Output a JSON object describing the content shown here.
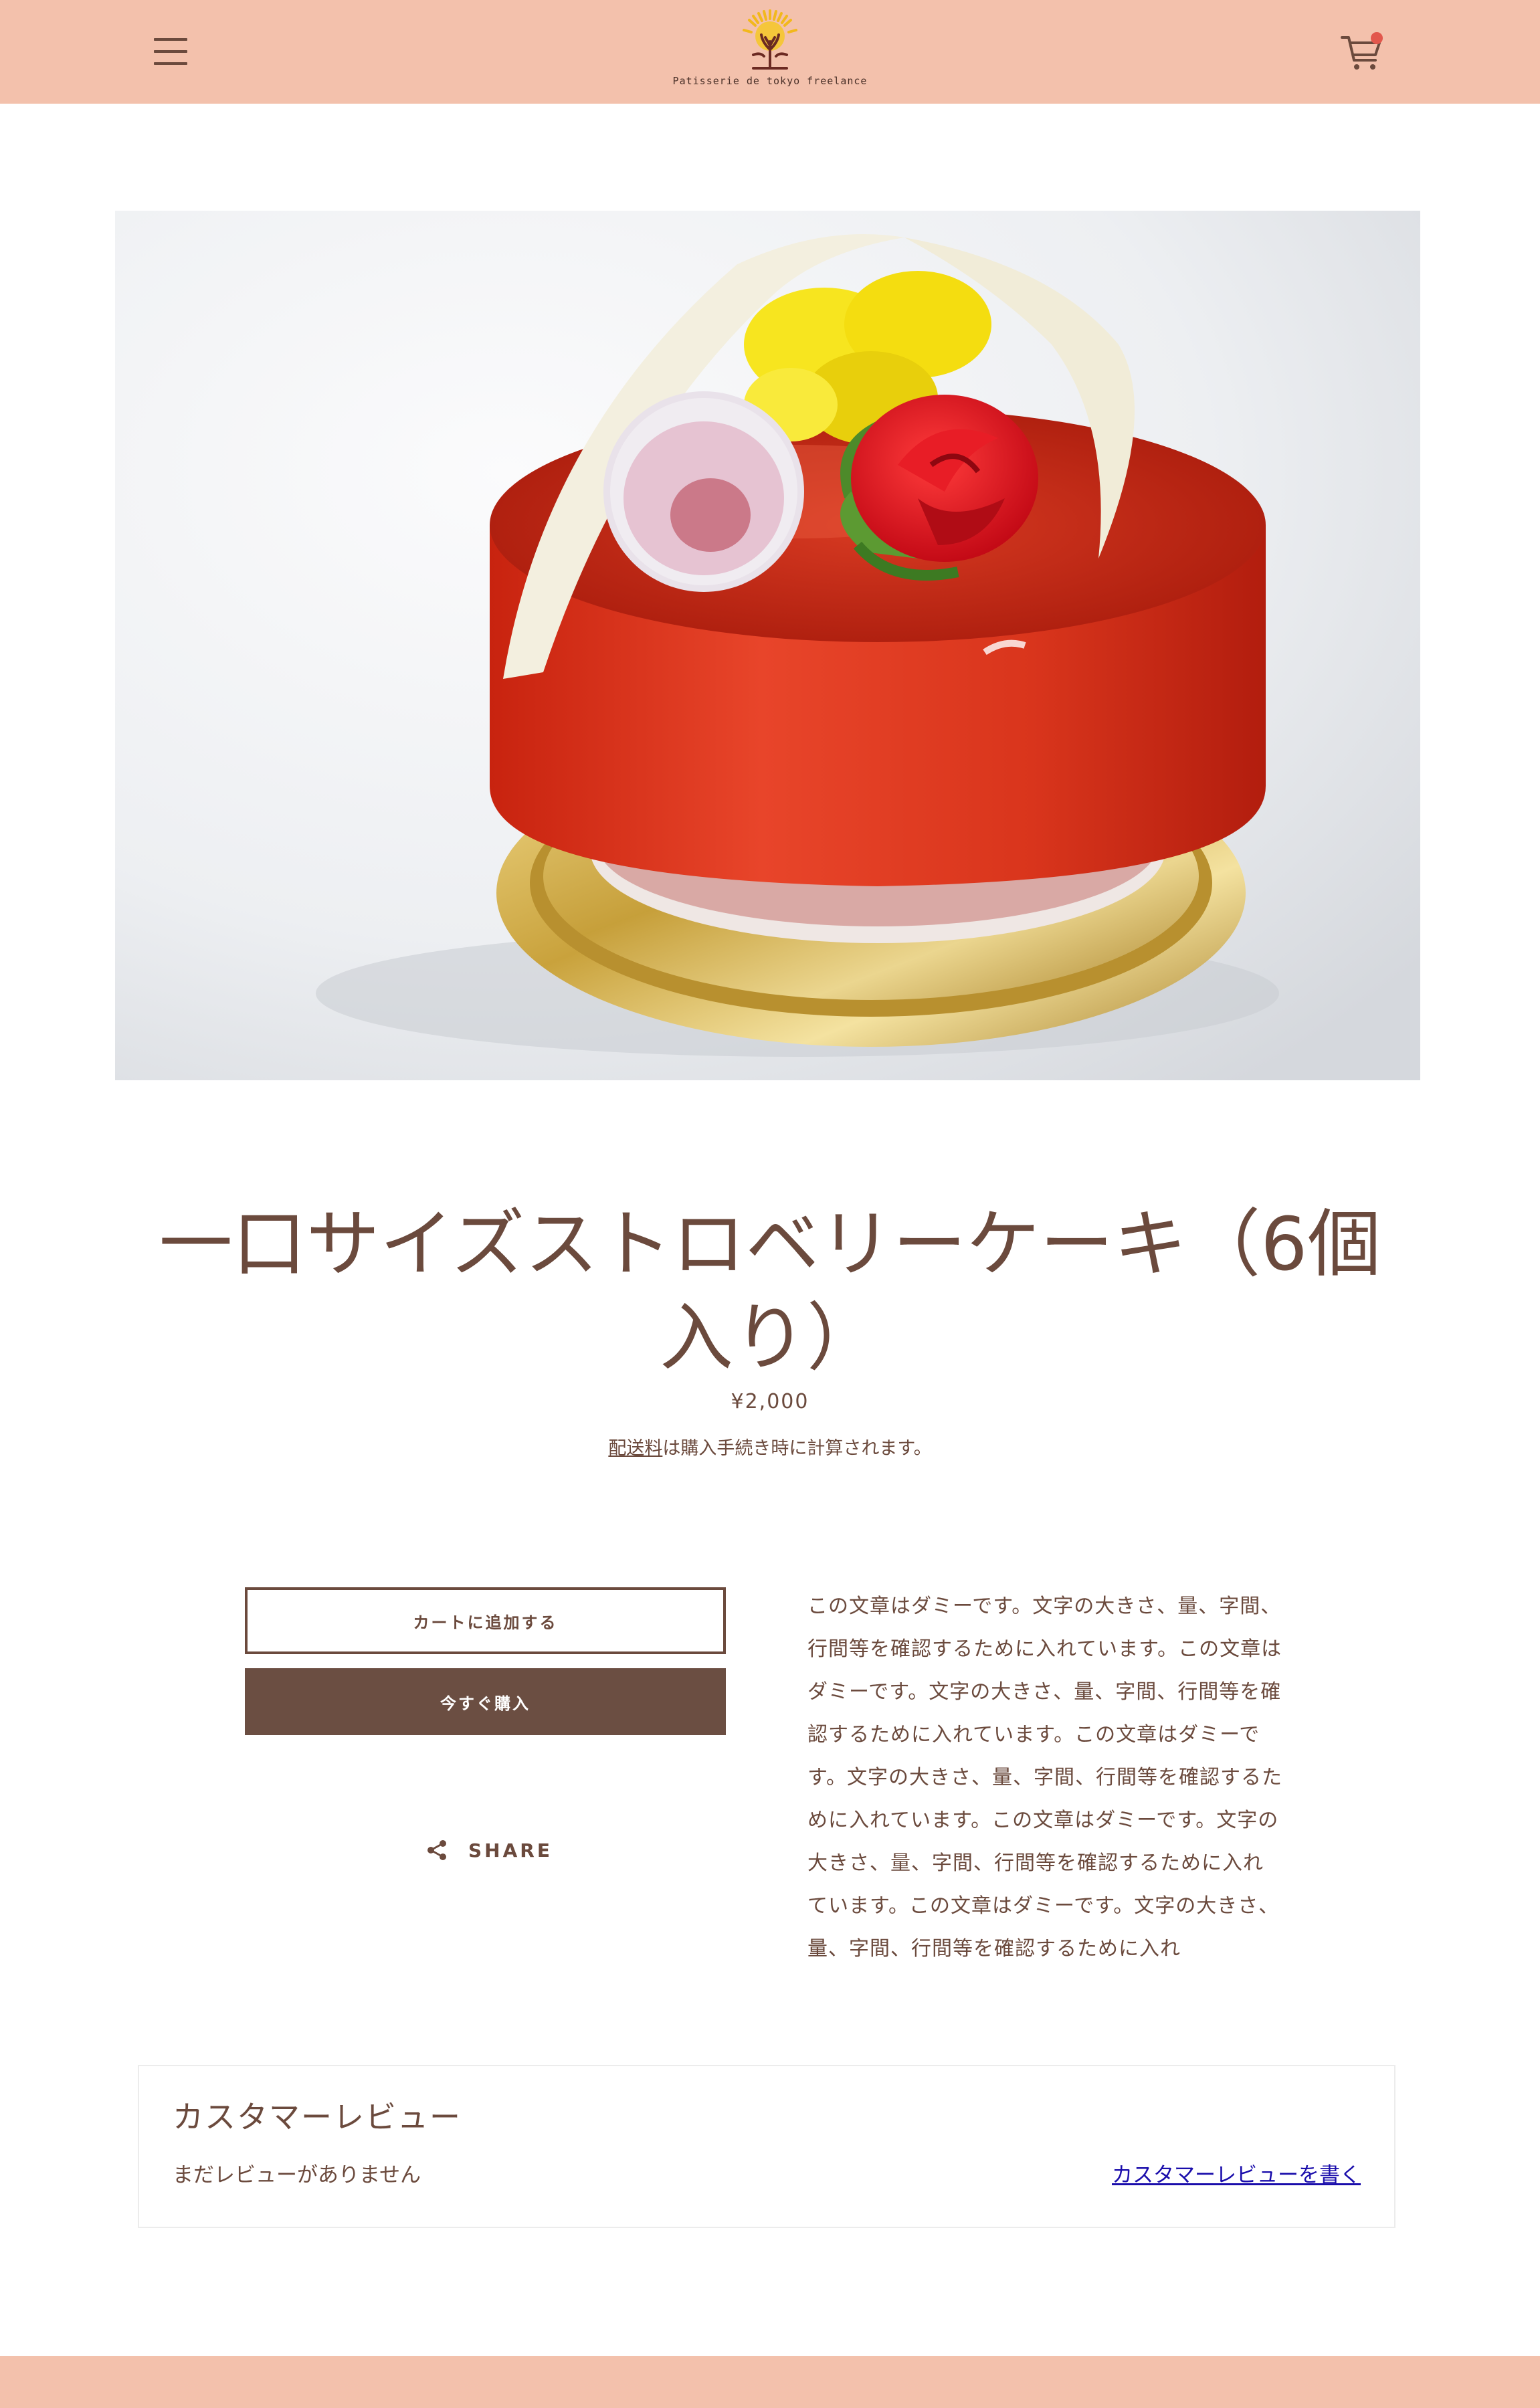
{
  "header": {
    "brand_name": "Patisserie de tokyo freelance",
    "menu_icon": "hamburger-menu-icon",
    "cart_icon": "shopping-cart-icon",
    "cart_has_items": true,
    "background_color": "#f3c1ac"
  },
  "product": {
    "image_subject": "strawberry mini cake with rose and glazing",
    "title": "一口サイズストロベリーケーキ（6個入り）",
    "price": "¥2,000",
    "shipping_link": "配送料",
    "shipping_note": "は購入手続き時に計算されます。",
    "add_to_cart_label": "カートに追加する",
    "buy_now_label": "今すぐ購入",
    "share_label": "SHARE",
    "description": "この文章はダミーです。文字の大きさ、量、字間、行間等を確認するために入れています。この文章はダミーです。文字の大きさ、量、字間、行間等を確認するために入れています。この文章はダミーです。文字の大きさ、量、字間、行間等を確認するために入れています。この文章はダミーです。文字の大きさ、量、字間、行間等を確認するために入れています。この文章はダミーです。文字の大きさ、量、字間、行間等を確認するために入れ"
  },
  "reviews": {
    "title": "カスタマーレビュー",
    "empty_text": "まだレビューがありません",
    "write_link": "カスタマーレビューを書く"
  },
  "colors": {
    "brand_brown": "#6b4a3d",
    "button_brown": "#6b4e42",
    "peach": "#f3c1ac",
    "cart_badge": "#e2574c",
    "link_blue": "#1a0dab"
  }
}
